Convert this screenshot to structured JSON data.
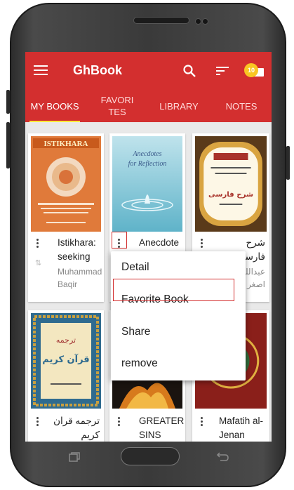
{
  "app": {
    "title": "GhBook",
    "notification_count": "10",
    "accent_color": "#d32f2f"
  },
  "tabs": [
    {
      "label": "MY BOOKS",
      "active": true
    },
    {
      "label": "FAVORITES",
      "active": false
    },
    {
      "label": "LIBRARY",
      "active": false
    },
    {
      "label": "NOTES",
      "active": false
    }
  ],
  "books": [
    {
      "title": "Istikhara: seeking",
      "author": "Muhammad Baqir",
      "cover_text": "ISTIKHARA"
    },
    {
      "title": "Anecdote",
      "cover_text": "Anecdotes for Reflection"
    },
    {
      "title": "شرح فارسی",
      "author": "عبدالله اصغر",
      "cover_text": "شرح فارسی"
    },
    {
      "title": "ترجمه قران کريم",
      "cover_text": "ترجمه قرآن کریم"
    },
    {
      "title": "GREATER SINS"
    },
    {
      "title": "Mafatih al-Jenan"
    }
  ],
  "context_menu": {
    "items": [
      "Detail",
      "Favorite Book",
      "Share",
      "remove"
    ],
    "highlighted": "Favorite Book"
  },
  "icons": [
    "menu-icon",
    "search-icon",
    "sort-icon",
    "notification-icon",
    "overflow-menu-icon",
    "recent-apps-icon",
    "home-button",
    "back-icon"
  ]
}
